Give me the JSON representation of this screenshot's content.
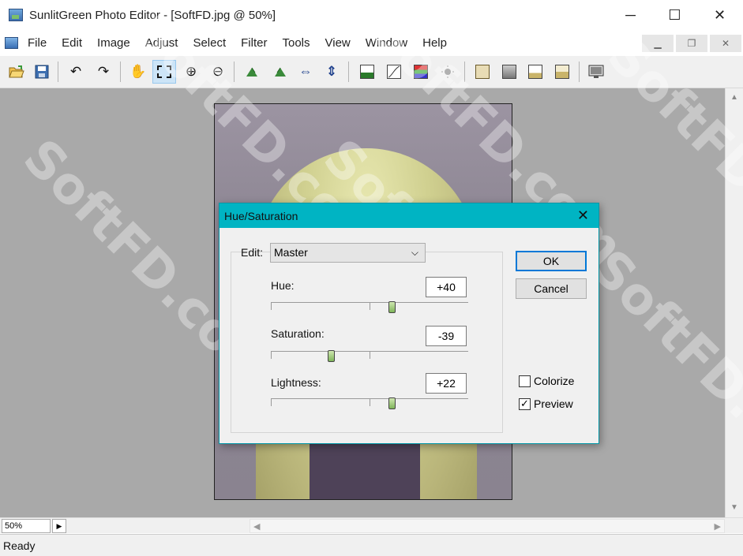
{
  "window": {
    "title": "SunlitGreen Photo Editor - [SoftFD.jpg @ 50%]",
    "minimize": "─",
    "maximize": "☐",
    "close": "✕"
  },
  "menu": {
    "items": [
      "File",
      "Edit",
      "Image",
      "Adjust",
      "Select",
      "Filter",
      "Tools",
      "View",
      "Window",
      "Help"
    ],
    "mdi_minimize": "▁",
    "mdi_restore": "❐",
    "mdi_close": "✕"
  },
  "toolbar": {
    "open_icon": "folder-open",
    "save_icon": "floppy-disk",
    "undo_icon": "↶",
    "redo_icon": "↷",
    "hand_icon": "✋",
    "zoom_in_icon": "⊕",
    "zoom_out_icon": "⊖",
    "flip_h_icon": "⇔",
    "flip_v_icon": "⇕"
  },
  "status": {
    "zoom": "50%",
    "text": "Ready"
  },
  "dialog": {
    "title": "Hue/Saturation",
    "close": "✕",
    "edit_label": "Edit:",
    "edit_value": "Master",
    "hue_label": "Hue:",
    "hue_value": "+40",
    "hue_fraction": 0.61,
    "saturation_label": "Saturation:",
    "saturation_value": "-39",
    "saturation_fraction": 0.305,
    "lightness_label": "Lightness:",
    "lightness_value": "+22",
    "lightness_fraction": 0.61,
    "ok_label": "OK",
    "cancel_label": "Cancel",
    "colorize_label": "Colorize",
    "colorize_checked": false,
    "preview_label": "Preview",
    "preview_checked": true
  },
  "watermark": "SoftFD.com"
}
